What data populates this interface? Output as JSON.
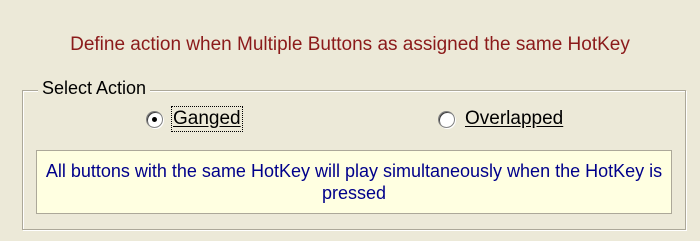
{
  "header": {
    "text": "Define action when Multiple Buttons as assigned the same HotKey"
  },
  "group": {
    "title": "Select Action"
  },
  "options": {
    "ganged": {
      "label": "Ganged",
      "selected": true
    },
    "overlapped": {
      "label": "Overlapped",
      "selected": false
    }
  },
  "description": {
    "text": "All buttons with the same HotKey will play simultaneously when the HotKey is pressed"
  },
  "colors": {
    "header_text": "#8b1a1a",
    "description_text": "#00008b",
    "description_bg": "#ffffe1",
    "dialog_bg": "#ece9d8"
  }
}
